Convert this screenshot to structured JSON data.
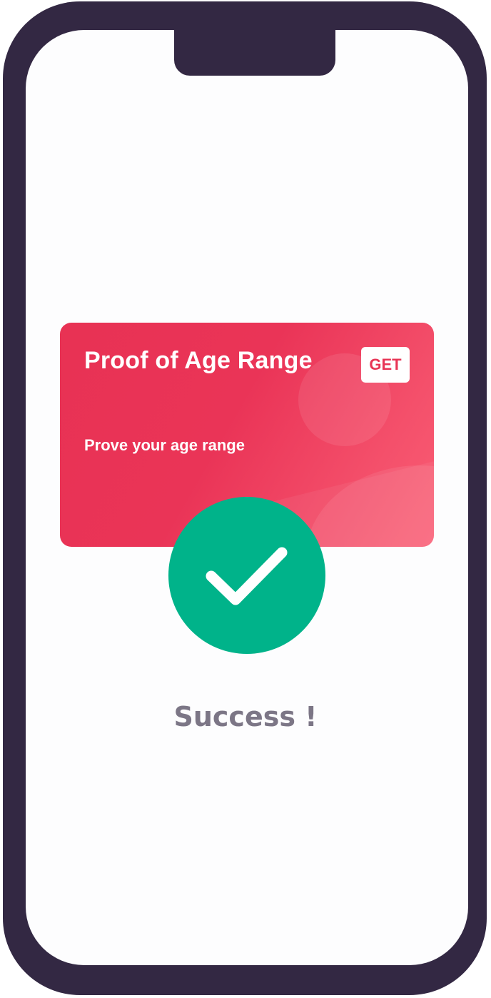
{
  "card": {
    "title": "Proof of Age Range",
    "subtitle": "Prove your age range",
    "action_label": "GET",
    "gradient_start": "#e83254",
    "gradient_end": "#fa5d74"
  },
  "status": {
    "icon": "check-circle-icon",
    "icon_color": "#00b38a",
    "message": "Success !"
  },
  "colors": {
    "device_frame": "#332843",
    "screen": "#fdfdfe",
    "message_text": "#7c7686"
  }
}
